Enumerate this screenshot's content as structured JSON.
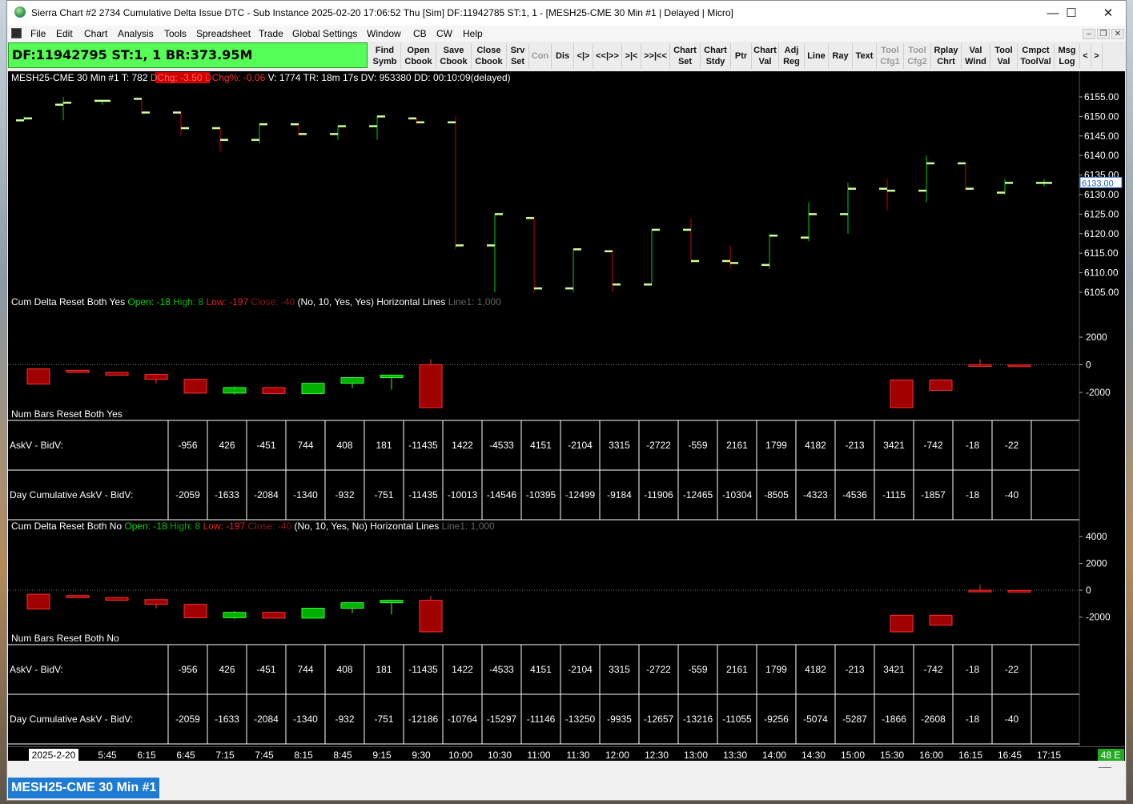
{
  "window": {
    "title": "Sierra Chart #2 2734 Cumulative Delta Issue DTC - Sub Instance 2025-02-20  17:06:52 Thu [Sim] DF:11942785  ST:1, 1  - [MESH25-CME  30 Min  #1 | Delayed | Micro]",
    "minimize": "—",
    "maximize": "☐",
    "close": "✕"
  },
  "menu": [
    "File",
    "Edit",
    "Chart",
    "Analysis",
    "Tools",
    "Spreadsheet",
    "Trade",
    "Global Settings",
    "Window",
    "CB",
    "CW",
    "Help"
  ],
  "mdi": {
    "min": "–",
    "restore": "❐",
    "close": "✕"
  },
  "toolbar": {
    "df_status": "DF:11942795  ST:1, 1  BR:373.95M",
    "buttons": [
      {
        "label": "Find\nSymb",
        "enabled": true
      },
      {
        "label": "Open\nCbook",
        "enabled": true
      },
      {
        "label": "Save\nCbook",
        "enabled": true
      },
      {
        "label": "Close\nCbook",
        "enabled": true
      },
      {
        "label": "Srv\nSet",
        "enabled": true
      },
      {
        "label": "Con",
        "enabled": false
      },
      {
        "label": "Dis",
        "enabled": true
      },
      {
        "label": "<|>",
        "enabled": true
      },
      {
        "label": "<<|>>",
        "enabled": true
      },
      {
        "label": ">|<",
        "enabled": true
      },
      {
        "label": ">>|<<",
        "enabled": true
      },
      {
        "label": "Chart\nSet",
        "enabled": true
      },
      {
        "label": "Chart\nStdy",
        "enabled": true
      },
      {
        "label": "Ptr",
        "enabled": true
      },
      {
        "label": "Chart\nVal",
        "enabled": true
      },
      {
        "label": "Adj\nReg",
        "enabled": true
      },
      {
        "label": "Line",
        "enabled": true
      },
      {
        "label": "Ray",
        "enabled": true
      },
      {
        "label": "Text",
        "enabled": true
      },
      {
        "label": "Tool\nCfg1",
        "enabled": false
      },
      {
        "label": "Tool\nCfg2",
        "enabled": false
      },
      {
        "label": "Rplay\nChrt",
        "enabled": true
      },
      {
        "label": "Val\nWind",
        "enabled": true
      },
      {
        "label": "Tool\nVal",
        "enabled": true
      },
      {
        "label": "Cmpct\nToolVal",
        "enabled": true
      },
      {
        "label": "Msg\nLog",
        "enabled": true
      },
      {
        "label": "<",
        "enabled": true
      },
      {
        "label": ">",
        "enabled": true
      }
    ]
  },
  "chart": {
    "header": {
      "main": "MESH25-CME  30 Min  #1 T: 782",
      "dchg": "DChg: -3.50",
      "dchgpct": "DChg%: -0.06",
      "rest": "V: 1774 TR: 18m 17s DV: 953380 DD: 00:10:09(delayed)"
    },
    "current_price": "6133.00",
    "price_axis": [
      "6155.00",
      "6150.00",
      "6145.00",
      "6140.00",
      "6135.00",
      "6130.00",
      "6125.00",
      "6120.00",
      "6115.00",
      "6110.00",
      "6105.00"
    ],
    "price_axis_values": [
      6155,
      6150,
      6145,
      6140,
      6135,
      6130,
      6125,
      6120,
      6115,
      6110,
      6105
    ],
    "bars": [
      {
        "o": 6149,
        "h": 6150,
        "l": 6149,
        "c": 6149.5
      },
      {
        "o": 6153,
        "h": 6155,
        "l": 6149,
        "c": 6153.5
      },
      {
        "o": 6154,
        "h": 6154,
        "l": 6153,
        "c": 6154
      },
      {
        "o": 6154.5,
        "h": 6154.5,
        "l": 6150.5,
        "c": 6151
      },
      {
        "o": 6151,
        "h": 6151,
        "l": 6145,
        "c": 6147
      },
      {
        "o": 6147,
        "h": 6147,
        "l": 6141,
        "c": 6144
      },
      {
        "o": 6144,
        "h": 6148,
        "l": 6143,
        "c": 6148
      },
      {
        "o": 6148,
        "h": 6148,
        "l": 6145,
        "c": 6145.5
      },
      {
        "o": 6145.5,
        "h": 6147.5,
        "l": 6144,
        "c": 6147.5
      },
      {
        "o": 6147.5,
        "h": 6150,
        "l": 6144,
        "c": 6150
      },
      {
        "o": 6149.5,
        "h": 6149.5,
        "l": 6148,
        "c": 6148.5
      },
      {
        "o": 6148.5,
        "h": 6150,
        "l": 6116,
        "c": 6117
      },
      {
        "o": 6117,
        "h": 6125,
        "l": 6105,
        "c": 6125
      },
      {
        "o": 6124,
        "h": 6124,
        "l": 6105,
        "c": 6106
      },
      {
        "o": 6106,
        "h": 6116,
        "l": 6105,
        "c": 6116
      },
      {
        "o": 6115.5,
        "h": 6115.5,
        "l": 6105,
        "c": 6107
      },
      {
        "o": 6107,
        "h": 6121,
        "l": 6107,
        "c": 6121
      },
      {
        "o": 6121,
        "h": 6124,
        "l": 6113,
        "c": 6113
      },
      {
        "o": 6113,
        "h": 6117,
        "l": 6111,
        "c": 6112.5
      },
      {
        "o": 6112,
        "h": 6120,
        "l": 6111,
        "c": 6119.5
      },
      {
        "o": 6119,
        "h": 6128,
        "l": 6118,
        "c": 6125
      },
      {
        "o": 6125,
        "h": 6133,
        "l": 6120,
        "c": 6131.5
      },
      {
        "o": 6131.5,
        "h": 6134,
        "l": 6126,
        "c": 6131
      },
      {
        "o": 6131,
        "h": 6140,
        "l": 6128,
        "c": 6138
      },
      {
        "o": 6138,
        "h": 6138,
        "l": 6131,
        "c": 6131.5
      },
      {
        "o": 6130.5,
        "h": 6134,
        "l": 6130,
        "c": 6133
      },
      {
        "o": 6133,
        "h": 6134,
        "l": 6132,
        "c": 6133
      }
    ],
    "cd1": {
      "label": "Cum Delta Reset Both Yes",
      "open": "Open: -18",
      "high": "High: 8",
      "low": "Low: -197",
      "close": "Close: -40",
      "params": "(No, 10, Yes, Yes)",
      "hl": "Horizontal Lines",
      "line1": "Line1: 1,000",
      "axis": [
        "2000",
        "0",
        "-2000"
      ],
      "axis_values": [
        2000,
        0,
        -2000
      ],
      "candles": [
        {
          "i": 1,
          "o": -300,
          "c": -1400,
          "h": -280,
          "l": -1400
        },
        {
          "i": 2,
          "o": -400,
          "c": -550,
          "h": -380,
          "l": -560
        },
        {
          "i": 3,
          "o": -550,
          "c": -750,
          "h": -520,
          "l": -780
        },
        {
          "i": 4,
          "o": -700,
          "c": -1050,
          "h": -650,
          "l": -1350
        },
        {
          "i": 5,
          "o": -1050,
          "c": -2050,
          "h": -1000,
          "l": -2100
        },
        {
          "i": 6,
          "o": -2050,
          "c": -1650,
          "h": -1550,
          "l": -2150
        },
        {
          "i": 7,
          "o": -1650,
          "c": -2080,
          "h": -1620,
          "l": -2100
        },
        {
          "i": 8,
          "o": -2080,
          "c": -1340,
          "h": -1300,
          "l": -2100
        },
        {
          "i": 9,
          "o": -1340,
          "c": -930,
          "h": -900,
          "l": -1700
        },
        {
          "i": 10,
          "o": -930,
          "c": -750,
          "h": -700,
          "l": -1800
        },
        {
          "i": 11,
          "o": 0,
          "c": -3100,
          "h": 400,
          "l": -3100
        },
        {
          "i": 23,
          "o": -1100,
          "c": -3100,
          "h": -1100,
          "l": -3100
        },
        {
          "i": 24,
          "o": -1100,
          "c": -1850,
          "h": -1100,
          "l": -1850
        },
        {
          "i": 25,
          "o": 0,
          "c": -18,
          "h": 400,
          "l": -30
        },
        {
          "i": 26,
          "o": -18,
          "c": -40,
          "h": -10,
          "l": -120
        }
      ]
    },
    "nb1": {
      "label": "Num Bars Reset Both Yes"
    },
    "table1": {
      "row1_label": "AskV - BidV:",
      "row2_label": "Day Cumulative AskV - BidV:",
      "row1": [
        "-956",
        "426",
        "-451",
        "744",
        "408",
        "181",
        "-11435",
        "1422",
        "-4533",
        "4151",
        "-2104",
        "3315",
        "-2722",
        "-559",
        "2161",
        "1799",
        "4182",
        "-213",
        "3421",
        "-742",
        "-18",
        "-22"
      ],
      "row2": [
        "-2059",
        "-1633",
        "-2084",
        "-1340",
        "-932",
        "-751",
        "-11435",
        "-10013",
        "-14546",
        "-10395",
        "-12499",
        "-9184",
        "-11906",
        "-12465",
        "-10304",
        "-8505",
        "-4323",
        "-4536",
        "-1115",
        "-1857",
        "-18",
        "-40"
      ]
    },
    "cd2": {
      "label": "Cum Delta Reset Both No",
      "open": "Open: -18",
      "high": "High: 8",
      "low": "Low: -197",
      "close": "Close: -40",
      "params": "(No, 10, Yes, No)",
      "hl": "Horizontal Lines",
      "line1": "Line1: 1,000",
      "axis": [
        "4000",
        "2000",
        "0",
        "-2000"
      ],
      "axis_values": [
        4000,
        2000,
        0,
        -2000
      ],
      "candles": [
        {
          "i": 1,
          "o": -300,
          "c": -1400,
          "h": -280,
          "l": -1400
        },
        {
          "i": 2,
          "o": -400,
          "c": -550,
          "h": -380,
          "l": -560
        },
        {
          "i": 3,
          "o": -550,
          "c": -750,
          "h": -520,
          "l": -780
        },
        {
          "i": 4,
          "o": -700,
          "c": -1050,
          "h": -650,
          "l": -1350
        },
        {
          "i": 5,
          "o": -1050,
          "c": -2050,
          "h": -1000,
          "l": -2100
        },
        {
          "i": 6,
          "o": -2050,
          "c": -1650,
          "h": -1550,
          "l": -2150
        },
        {
          "i": 7,
          "o": -1650,
          "c": -2080,
          "h": -1620,
          "l": -2100
        },
        {
          "i": 8,
          "o": -2080,
          "c": -1340,
          "h": -1300,
          "l": -2100
        },
        {
          "i": 9,
          "o": -1340,
          "c": -930,
          "h": -900,
          "l": -1700
        },
        {
          "i": 10,
          "o": -930,
          "c": -750,
          "h": -700,
          "l": -1800
        },
        {
          "i": 11,
          "o": -750,
          "c": -3100,
          "h": -400,
          "l": -3100
        },
        {
          "i": 23,
          "o": -1866,
          "c": -3100,
          "h": -1866,
          "l": -3100
        },
        {
          "i": 24,
          "o": -1866,
          "c": -2608,
          "h": -1866,
          "l": -2608
        },
        {
          "i": 25,
          "o": 0,
          "c": -18,
          "h": 400,
          "l": -30
        },
        {
          "i": 26,
          "o": -18,
          "c": -40,
          "h": -10,
          "l": -120
        }
      ]
    },
    "nb2": {
      "label": "Num Bars Reset Both No"
    },
    "table2": {
      "row1_label": "AskV - BidV:",
      "row2_label": "Day Cumulative AskV - BidV:",
      "row1": [
        "-956",
        "426",
        "-451",
        "744",
        "408",
        "181",
        "-11435",
        "1422",
        "-4533",
        "4151",
        "-2104",
        "3315",
        "-2722",
        "-559",
        "2161",
        "1799",
        "4182",
        "-213",
        "3421",
        "-742",
        "-18",
        "-22"
      ],
      "row2": [
        "-2059",
        "-1633",
        "-2084",
        "-1340",
        "-932",
        "-751",
        "-12186",
        "-10764",
        "-15297",
        "-11146",
        "-13250",
        "-9935",
        "-12657",
        "-13216",
        "-11055",
        "-9256",
        "-5074",
        "-5287",
        "-1866",
        "-2608",
        "-18",
        "-40"
      ]
    },
    "time_axis": [
      "2025-2-20",
      "5:45",
      "6:15",
      "6:45",
      "7:15",
      "7:45",
      "8:15",
      "8:45",
      "9:15",
      "9:30",
      "10:00",
      "10:30",
      "11:00",
      "11:30",
      "12:00",
      "12:30",
      "13:00",
      "13:30",
      "14:00",
      "14:30",
      "15:00",
      "15:30",
      "16:00",
      "16:15",
      "16:45",
      "17:15"
    ],
    "badge": "48 E"
  },
  "tab": {
    "label": "MESH25-CME  30 Min  #1"
  },
  "colors": {
    "up": "#00cc00",
    "down": "#cc0000",
    "bar_tick": "#ccff99",
    "green_text": "#00cc00",
    "red_bg": "#d00000"
  }
}
